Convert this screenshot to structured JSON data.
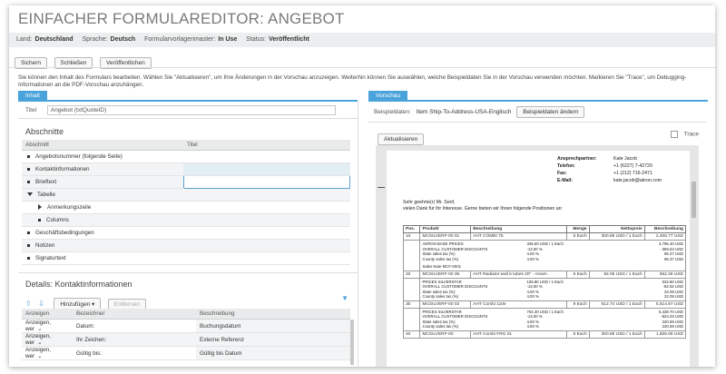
{
  "app_title": "EINFACHER FORMULAREDITOR: ANGEBOT",
  "infobar": {
    "land_label": "Land:",
    "land_value": "Deutschland",
    "sprache_label": "Sprache:",
    "sprache_value": "Deutsch",
    "master_label": "Formularvorlagenmaster:",
    "master_value": "In Use",
    "status_label": "Status:",
    "status_value": "Veröffentlicht"
  },
  "toolbar": {
    "save": "Sichern",
    "close": "Schließen",
    "publish": "Veröffentlichen"
  },
  "description": "Sie können den Inhalt des Formulars bearbeiten. Wählen Sie \"Aktualisieren\", um Ihre Änderungen in der Vorschau anzuzeigen. Weiterhin können Sie auswählen, welche Beispieldaten Sie in der Vorschau verwenden möchten. Markieren Sie \"Trace\", um Debugging-Informationen an die PDF-Vorschau anzuhängen.",
  "left": {
    "tab": "Inhalt",
    "title_label": "Titel",
    "title_value": "Angebot (txtQuoteID)",
    "sections_heading": "Abschnitte",
    "col_section": "Abschnitt",
    "col_title": "Titel",
    "sections": [
      {
        "label": "Angebotsnummer (folgende Seite)",
        "icon": "bullet",
        "indent": 0
      },
      {
        "label": "Kontaktinformationen",
        "icon": "bullet",
        "indent": 0
      },
      {
        "label": "Brieftext",
        "icon": "bullet",
        "indent": 0
      },
      {
        "label": "Tabelle",
        "icon": "collapse",
        "indent": 0
      },
      {
        "label": "Anmerkungszeile",
        "icon": "expand",
        "indent": 1
      },
      {
        "label": "Columns",
        "icon": "bullet",
        "indent": 1
      },
      {
        "label": "Geschäftsbedingungen",
        "icon": "bullet",
        "indent": 0
      },
      {
        "label": "Notizen",
        "icon": "bullet",
        "indent": 0
      },
      {
        "label": "Signaturtext",
        "icon": "bullet",
        "indent": 0
      }
    ],
    "details_heading": "Details: Kontaktinformationen",
    "add_button": "Hinzufügen",
    "remove_button": "Entfernen",
    "col_show": "Anzeigen",
    "col_name": "Bezeichner",
    "col_desc": "Beschreibung",
    "details": [
      {
        "show": "Anzeigen, wer",
        "name": "Datum:",
        "desc": "Buchungsdatum"
      },
      {
        "show": "Anzeigen, wer",
        "name": "Ihr Zeichen:",
        "desc": "Externe Referenz"
      },
      {
        "show": "Anzeigen, wer",
        "name": "Gültig bis:",
        "desc": "Gültig bis Datum"
      }
    ]
  },
  "right": {
    "tab": "Vorschau",
    "sample_label": "Beispieldaten:",
    "sample_value": "Item Ship-To-Address-USA-Englisch",
    "change_button": "Beispieldaten ändern",
    "refresh_button": "Aktualisieren",
    "trace_label": "Trace",
    "contact": [
      {
        "k": "Ansprechpartner:",
        "v": "Kate Jacob"
      },
      {
        "k": "Telefon:",
        "v": "+1 (6227) 7-42720"
      },
      {
        "k": "Fax:",
        "v": "+1 (212) 716-2471"
      },
      {
        "k": "E-Mail:",
        "v": "kate.jacob@akron.com"
      }
    ],
    "salutation": "Sehr geehrte(r) Mr. Senf,",
    "intro": "vielen Dank für Ihr Interesse. Gerne bieten wir Ihnen folgende Positionen an:",
    "headers": [
      "Pos.",
      "Produkt",
      "Beschreibung",
      "Menge",
      "Nettopreis",
      "Beschreibung"
    ],
    "items": [
      {
        "pos": "10",
        "prod": "MCSILVERF-00 01",
        "desc": "AHT COMBI 75",
        "qty": "6 Each",
        "price": "300.85 USD / 1 Each",
        "total": "2,406.77 USD",
        "sub": [
          "AKRON BASE PRICES|345.60 USD / 1 Each|3,796.40 USD",
          "OVERALL CUSTOMER DISCOUNTS|-13.00 %|-359.63 USD",
          "State sales tax (%)|4.00 %|96.37 USD",
          "County sales tax (%)|4.00 %|96.37 USD"
        ],
        "note": "Sales Note MCF-0001"
      },
      {
        "pos": "20",
        "prod": "MCSILVERF-00 36",
        "desc": "AHT Radiator wall 5 tubes 20\" - cream",
        "qty": "6 Each",
        "price": "92.05 USD / 1 Each",
        "total": "552.28 USD",
        "sub": [
          "PRICES SILVERSTAR|105.80 USD / 1 Each|534.80 USD",
          "OVERALL CUSTOMER DISCOUNTS|-13.00 %|-82.52 USD",
          "State sales tax (%)|4.00 %|22.09 USD",
          "County sales tax (%)|4.00 %|22.09 USD"
        ],
        "note": ""
      },
      {
        "pos": "30",
        "prod": "MCSILVERF-00 02",
        "desc": "AHT Combi 110e",
        "qty": "9 Each",
        "price": "612.74 USD / 1 Each",
        "total": "5,514.67 USD",
        "sub": [
          "PRICES SILVERSTAR|704.30 USD / 1 Each|6,338.70 USD",
          "OVERALL CUSTOMER DISCOUNTS|-13.00 %|-824.03 USD",
          "State sales tax (%)|4.00 %|220.59 USD",
          "County sales tax (%)|4.00 %|220.59 USD"
        ],
        "note": ""
      },
      {
        "pos": "40",
        "prod": "MCSILVERF-00",
        "desc": "AHT Combi FRG 01",
        "qty": "6 Each",
        "price": "300.85 USD / 1 Each",
        "total": "1,805.08 USD",
        "sub": [],
        "note": ""
      }
    ]
  }
}
